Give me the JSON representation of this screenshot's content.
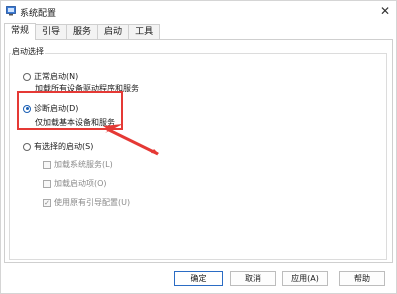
{
  "window": {
    "title": "系统配置",
    "close_glyph": "✕",
    "icon": "msconfig-icon"
  },
  "tabs": [
    {
      "label": "常规",
      "active": true
    },
    {
      "label": "引导",
      "active": false
    },
    {
      "label": "服务",
      "active": false
    },
    {
      "label": "启动",
      "active": false
    },
    {
      "label": "工具",
      "active": false
    }
  ],
  "startup_selection": {
    "group_label": "启动选择",
    "normal": {
      "label": "正常启动(N)",
      "description": "加载所有设备驱动程序和服务",
      "checked": false
    },
    "diagnostic": {
      "label": "诊断启动(D)",
      "description": "仅加载基本设备和服务",
      "checked": true
    },
    "selective": {
      "label": "有选择的启动(S)",
      "checked": false,
      "options": [
        {
          "label": "加载系统服务(L)",
          "checked": false,
          "enabled": false
        },
        {
          "label": "加载启动项(O)",
          "checked": false,
          "enabled": false
        },
        {
          "label": "使用原有引导配置(U)",
          "checked": true,
          "enabled": false
        }
      ]
    }
  },
  "buttons": {
    "ok": "确定",
    "cancel": "取消",
    "apply": "应用(A)",
    "help": "帮助"
  },
  "annotation": {
    "highlight_color": "#e53935"
  },
  "colors": {
    "accent": "#1a5fb4",
    "border": "#cfcfcf"
  }
}
